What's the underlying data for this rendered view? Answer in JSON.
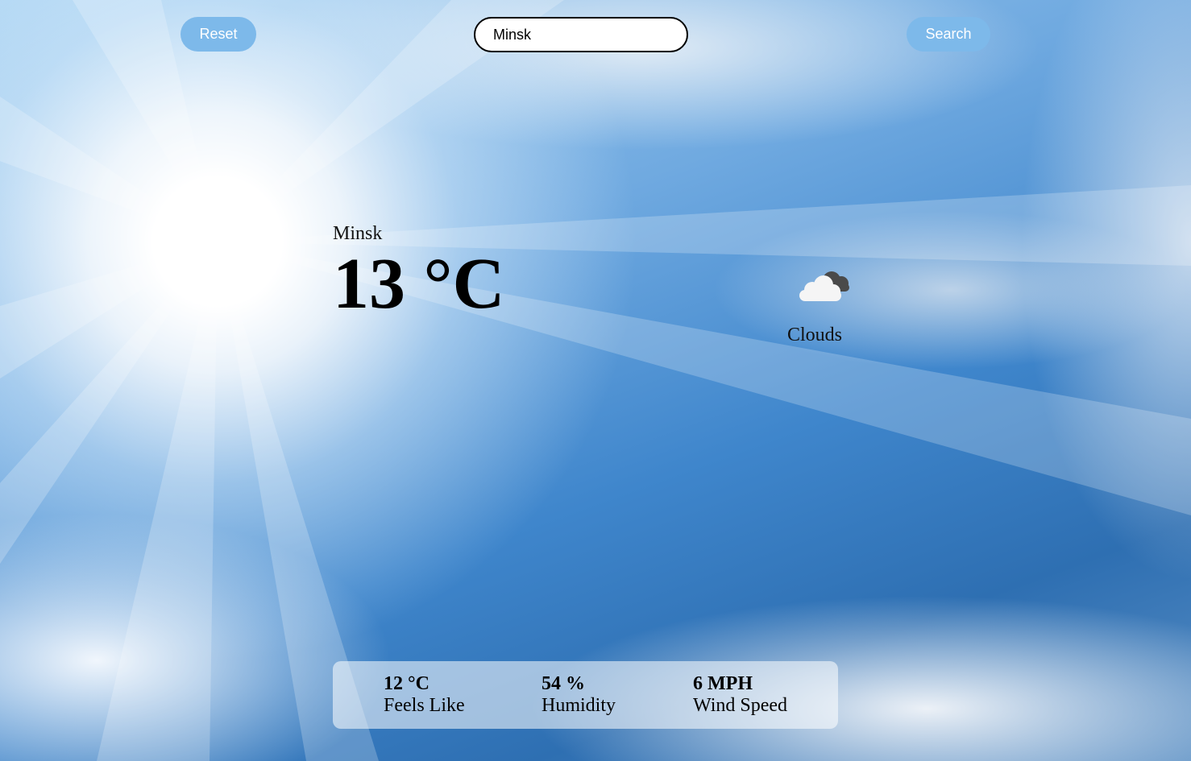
{
  "toolbar": {
    "reset_label": "Reset",
    "search_label": "Search"
  },
  "search": {
    "value": "Minsk",
    "placeholder": ""
  },
  "current": {
    "city": "Minsk",
    "temperature": "13 °C",
    "condition": "Clouds",
    "icon": "cloud-icon"
  },
  "details": {
    "feels_like": {
      "value": "12 °C",
      "label": "Feels Like"
    },
    "humidity": {
      "value": "54 %",
      "label": "Humidity"
    },
    "wind_speed": {
      "value": "6 MPH",
      "label": "Wind Speed"
    }
  },
  "colors": {
    "button": "#7db9ea",
    "sky": "#3f86cc"
  }
}
